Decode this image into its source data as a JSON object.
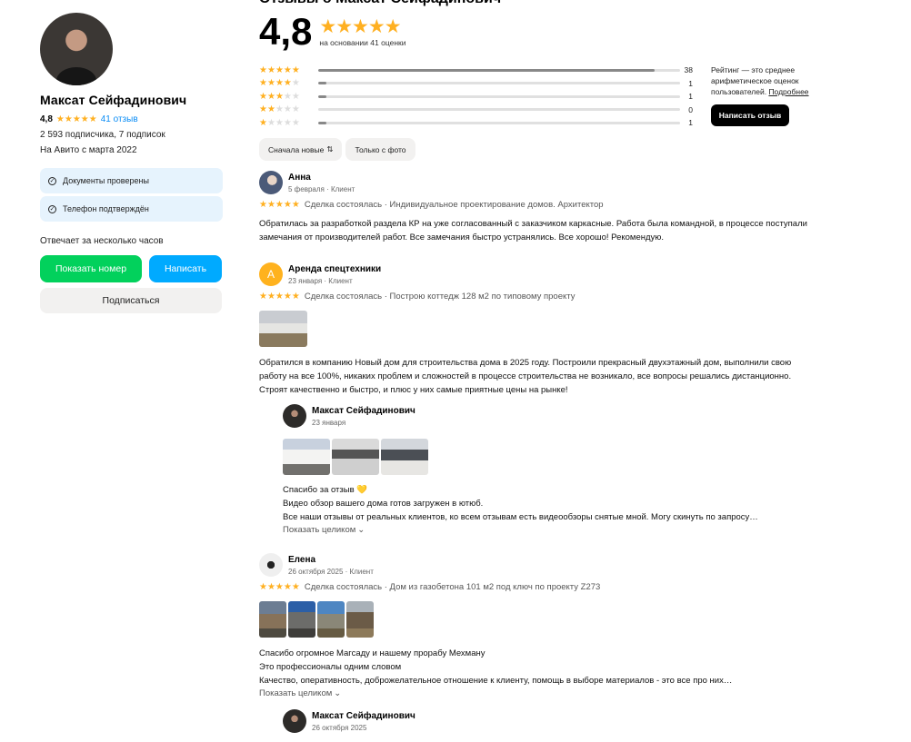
{
  "profile": {
    "name": "Максат Сейфадинович",
    "rating": "4,8",
    "stars": "★★★★★",
    "reviews_link": "41 отзыв",
    "subscribers": "2 593 подписчика, 7 подписок",
    "since": "На Авито с марта 2022",
    "verifications": [
      "Документы проверены",
      "Телефон подтверждён"
    ],
    "response_time": "Отвечает за несколько часов",
    "show_number_label": "Показать номер",
    "write_label": "Написать",
    "subscribe_label": "Подписаться"
  },
  "summary": {
    "cut_header": "Отзывы о Максат Сейфадинович",
    "rating": "4,8",
    "stars": "★★★★★",
    "basis": "на основании 41 оценки",
    "distribution": [
      {
        "stars": 5,
        "count": "38",
        "fraction": 0.93
      },
      {
        "stars": 4,
        "count": "1",
        "fraction": 0.025
      },
      {
        "stars": 3,
        "count": "1",
        "fraction": 0.025
      },
      {
        "stars": 2,
        "count": "0",
        "fraction": 0
      },
      {
        "stars": 1,
        "count": "1",
        "fraction": 0.025
      }
    ],
    "note_text": "Рейтинг — это среднее арифметическое оценок пользователей.",
    "note_link": "Подробнее",
    "write_review_label": "Написать отзыв"
  },
  "filters": {
    "sort_label": "Сначала новые",
    "sort_icon": "⇅",
    "photos_label": "Только с фото"
  },
  "reviews": [
    {
      "author": "Анна",
      "date": "5 февраля · Клиент",
      "stars": "★★★★★",
      "deal": "Сделка состоялась · Индивидуальное проектирование домов. Архитектор",
      "text": "Обратилась за разработкой раздела КР на уже согласованный с заказчиком каркасные. Работа была командной, в процессе поступали замечания от производителей работ. Все замечания быстро устранялись. Все хорошо! Рекомендую."
    },
    {
      "author": "Аренда спецтехники",
      "avatar_letter": "А",
      "date": "23 января · Клиент",
      "stars": "★★★★★",
      "deal": "Сделка состоялась · Построю коттедж 128 м2 по типовому проекту",
      "text": "Обратился в компанию Новый дом для строительства дома в 2025 году. Построили прекрасный двухэтажный дом, выполнили свою работу на все 100%, никаких проблем и сложностей в процессе строительства не возникало, все вопросы решались дистанционно. Строят качественно и быстро, и плюс у них самые приятные цены на рынке!",
      "reply": {
        "author": "Максат Сейфадинович",
        "date": "23 января",
        "lines": [
          "Спасибо за отзыв 💛",
          "Видео обзор вашего дома готов загружен в ютюб.",
          "Все наши отзывы от реальных клиентов, ко всем отзывам есть видеообзоры снятые мной. Могу скинуть по запросу…"
        ],
        "more": "Показать целиком"
      }
    },
    {
      "author": "Елена",
      "date": "26 октября 2025 · Клиент",
      "stars": "★★★★★",
      "deal": "Сделка состоялась · Дом из газобетона 101 м2 под ключ по проекту Z273",
      "lines": [
        "Спасибо огромное Магсаду и нашему прорабу Мехману",
        "Это профессионалы одним словом",
        "Качество, оперативность, доброжелательное отношение к клиенту, помощь в выборе материалов - это все про них…"
      ],
      "more": "Показать целиком",
      "reply": {
        "author": "Максат Сейфадинович",
        "date": "26 октября 2025"
      }
    }
  ],
  "colors": {
    "star": "#ffb021",
    "green_button": "#02d15c",
    "blue_button": "#00aaff",
    "link": "#0a8cf5"
  }
}
